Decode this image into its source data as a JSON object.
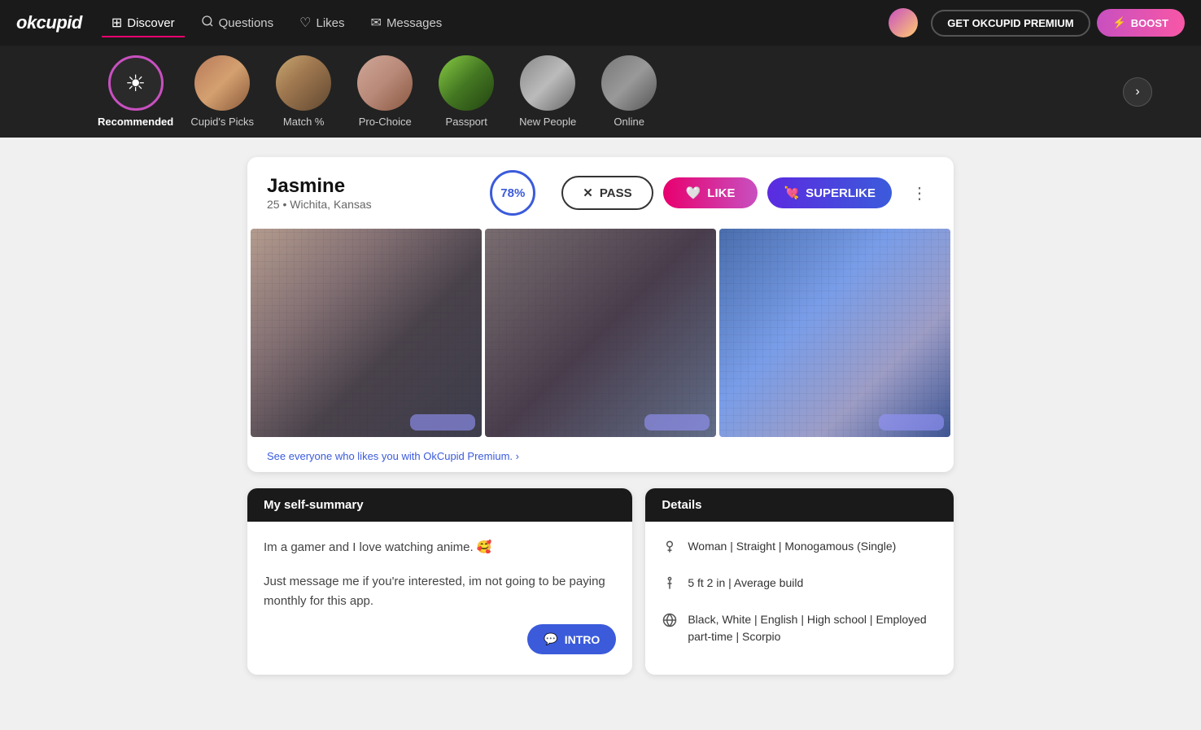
{
  "brand": "okcupid",
  "nav": {
    "items": [
      {
        "id": "discover",
        "label": "Discover",
        "icon": "⊞",
        "active": true
      },
      {
        "id": "questions",
        "label": "Questions",
        "icon": "❓"
      },
      {
        "id": "likes",
        "label": "Likes",
        "icon": "♡"
      },
      {
        "id": "messages",
        "label": "Messages",
        "icon": "✉"
      }
    ],
    "premium_btn": "GET OKCUPID PREMIUM",
    "boost_btn": "BOOST",
    "boost_icon": "⚡"
  },
  "categories": [
    {
      "id": "recommended",
      "label": "Recommended",
      "active": true,
      "is_icon": true
    },
    {
      "id": "cupids-picks",
      "label": "Cupid's Picks",
      "active": false
    },
    {
      "id": "match",
      "label": "Match %",
      "active": false
    },
    {
      "id": "pro-choice",
      "label": "Pro-Choice",
      "active": false
    },
    {
      "id": "passport",
      "label": "Passport",
      "active": false
    },
    {
      "id": "new-people",
      "label": "New People",
      "active": false
    },
    {
      "id": "online",
      "label": "Online",
      "active": false
    }
  ],
  "profile": {
    "name": "Jasmine",
    "age": "25",
    "location": "Wichita, Kansas",
    "match_percent": "78%",
    "pass_label": "PASS",
    "like_label": "LIKE",
    "superlike_label": "SUPERLIKE",
    "premium_link": "See everyone who likes you with OkCupid Premium. ›",
    "self_summary_header": "My self-summary",
    "self_summary_line1": "Im a gamer and I love watching anime. 🥰",
    "self_summary_line2": "Just message me if you're interested, im not going to be paying monthly for this app.",
    "intro_label": "INTRO",
    "details_header": "Details",
    "details": [
      {
        "icon": "gender",
        "text": "Woman | Straight | Monogamous (Single)"
      },
      {
        "icon": "height",
        "text": "5 ft 2 in | Average build"
      },
      {
        "icon": "globe",
        "text": "Black, White | English | High school | Employed part-time | Scorpio"
      }
    ]
  }
}
